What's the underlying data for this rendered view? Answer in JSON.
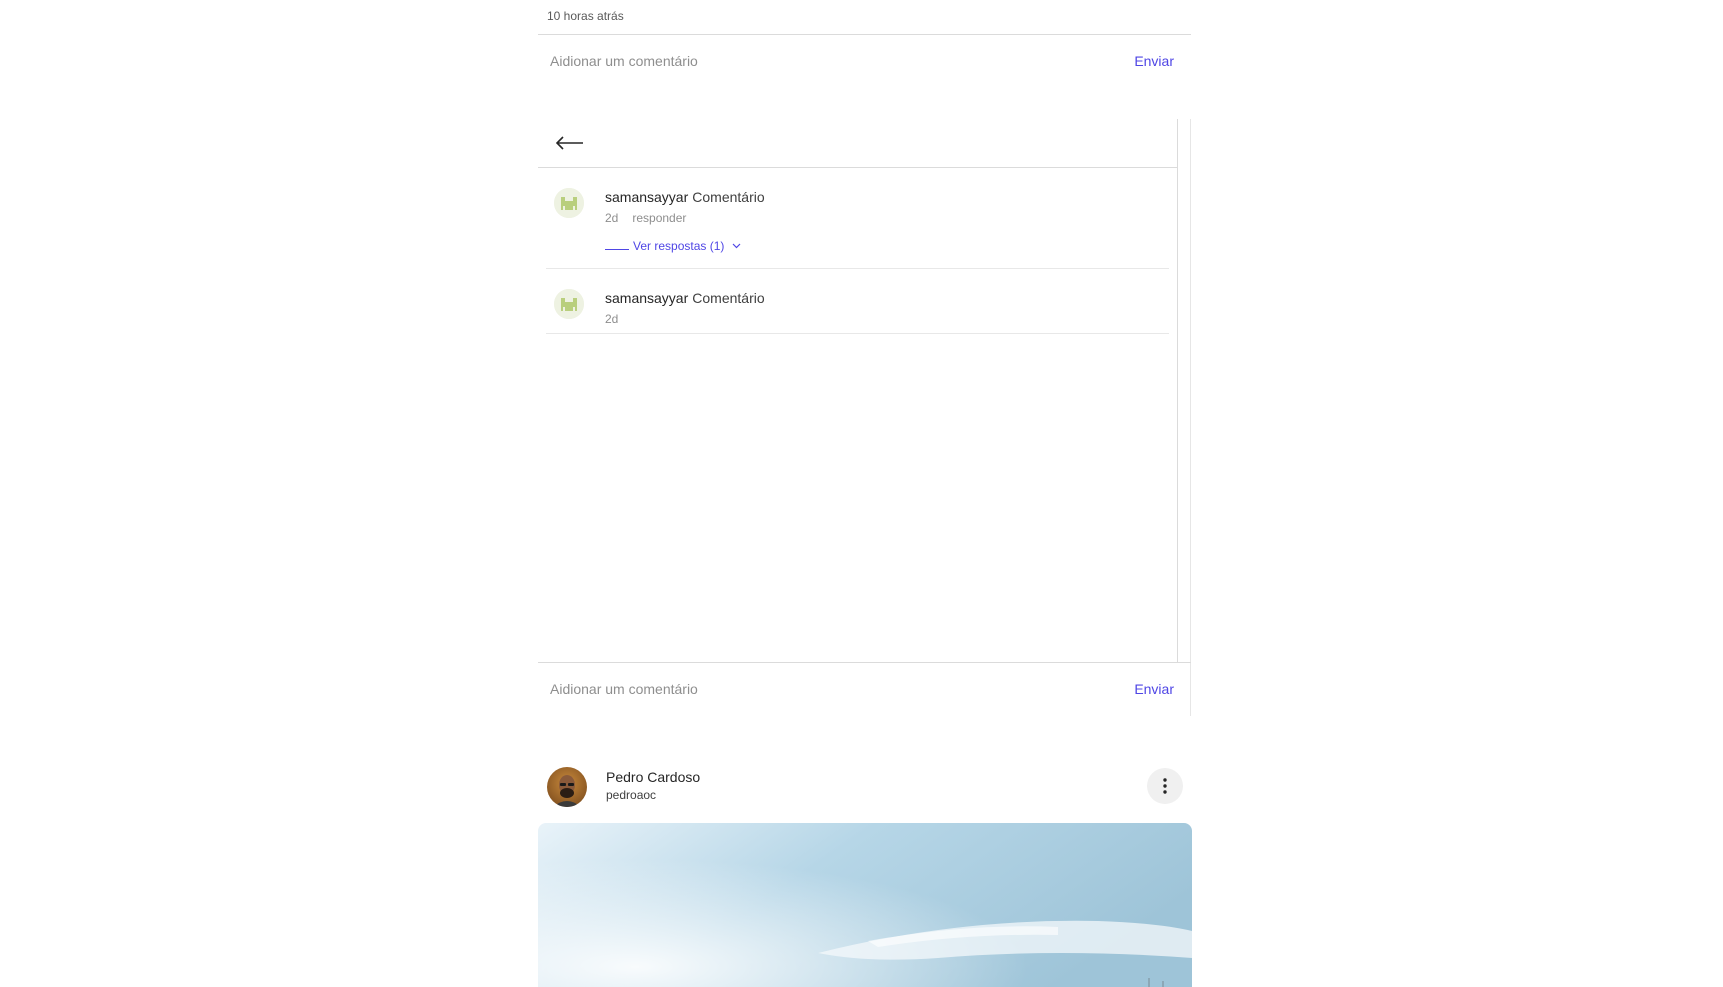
{
  "previous_post": {
    "timestamp": "10 horas atrás",
    "comment_placeholder": "Aidionar um comentário",
    "send_label": "Enviar"
  },
  "comments_panel": {
    "comments": [
      {
        "username": "samansayyar",
        "text": "Comentário",
        "age": "2d",
        "reply_label": "responder",
        "view_replies_label": "Ver respostas (1)"
      },
      {
        "username": "samansayyar",
        "text": "Comentário",
        "age": "2d"
      }
    ],
    "comment_placeholder": "Aidionar um comentário",
    "send_label": "Enviar"
  },
  "next_post": {
    "author_name": "Pedro Cardoso",
    "author_handle": "pedroaoc"
  },
  "icons": {
    "back": "arrow-left-icon",
    "more": "vertical-dots-icon",
    "chevron": "chevron-down-icon"
  },
  "colors": {
    "accent": "#4f46e5",
    "border": "#dbdbdb",
    "muted_text": "#8e8e8e"
  }
}
